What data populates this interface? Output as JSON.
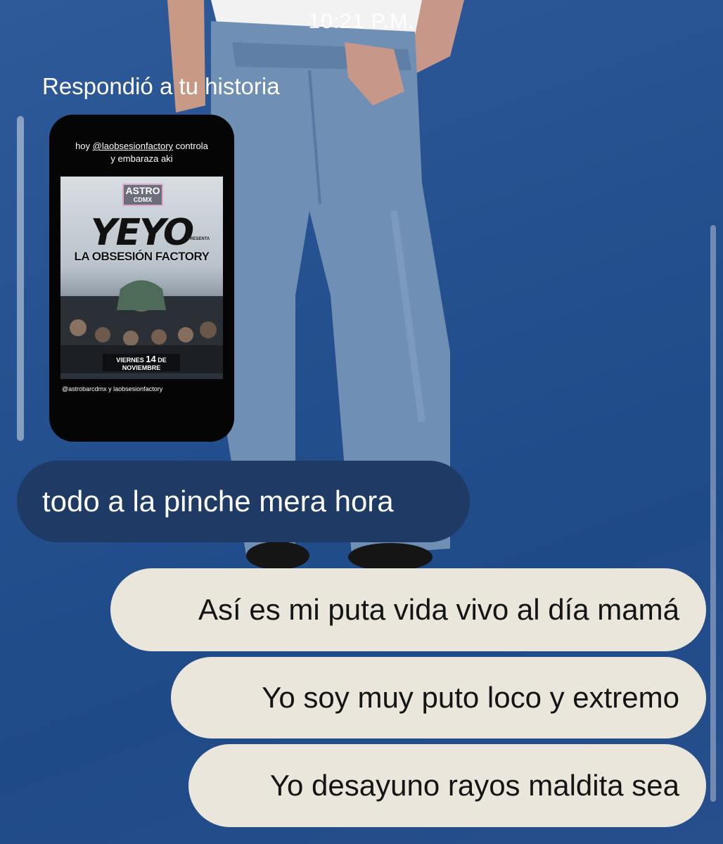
{
  "status_bar": {
    "time": "10:21 P.M."
  },
  "story_reply": {
    "label": "Respondió a tu historia",
    "story": {
      "caption_prefix": "hoy ",
      "caption_mention": "@laobsesionfactory",
      "caption_suffix": " controla",
      "caption_line2": "y embaraza aki",
      "poster": {
        "logo_top": "ASTRO",
        "logo_bottom": "CDMX",
        "title": "YEYO",
        "presenta": "PRESENTA",
        "subtitle": "LA OBSESIÓN FACTORY",
        "date_prefix": "VIERNES",
        "date_day": "14",
        "date_suffix": "DE NOVIEMBRE"
      },
      "footer": "@astrobarcdmx y laobsesionfactory"
    }
  },
  "messages": [
    {
      "direction": "incoming",
      "text": "todo a la pinche mera hora"
    },
    {
      "direction": "outgoing",
      "text": "Así es mi puta vida vivo al día mamá"
    },
    {
      "direction": "outgoing",
      "text": "Yo soy muy puto loco y extremo"
    },
    {
      "direction": "outgoing",
      "text": "Yo desayuno rayos maldita sea"
    }
  ],
  "colors": {
    "background": "#24508f",
    "incoming_bubble": "#1f3a64",
    "outgoing_bubble": "#ebe6db",
    "denim": "#6f8fb4"
  }
}
